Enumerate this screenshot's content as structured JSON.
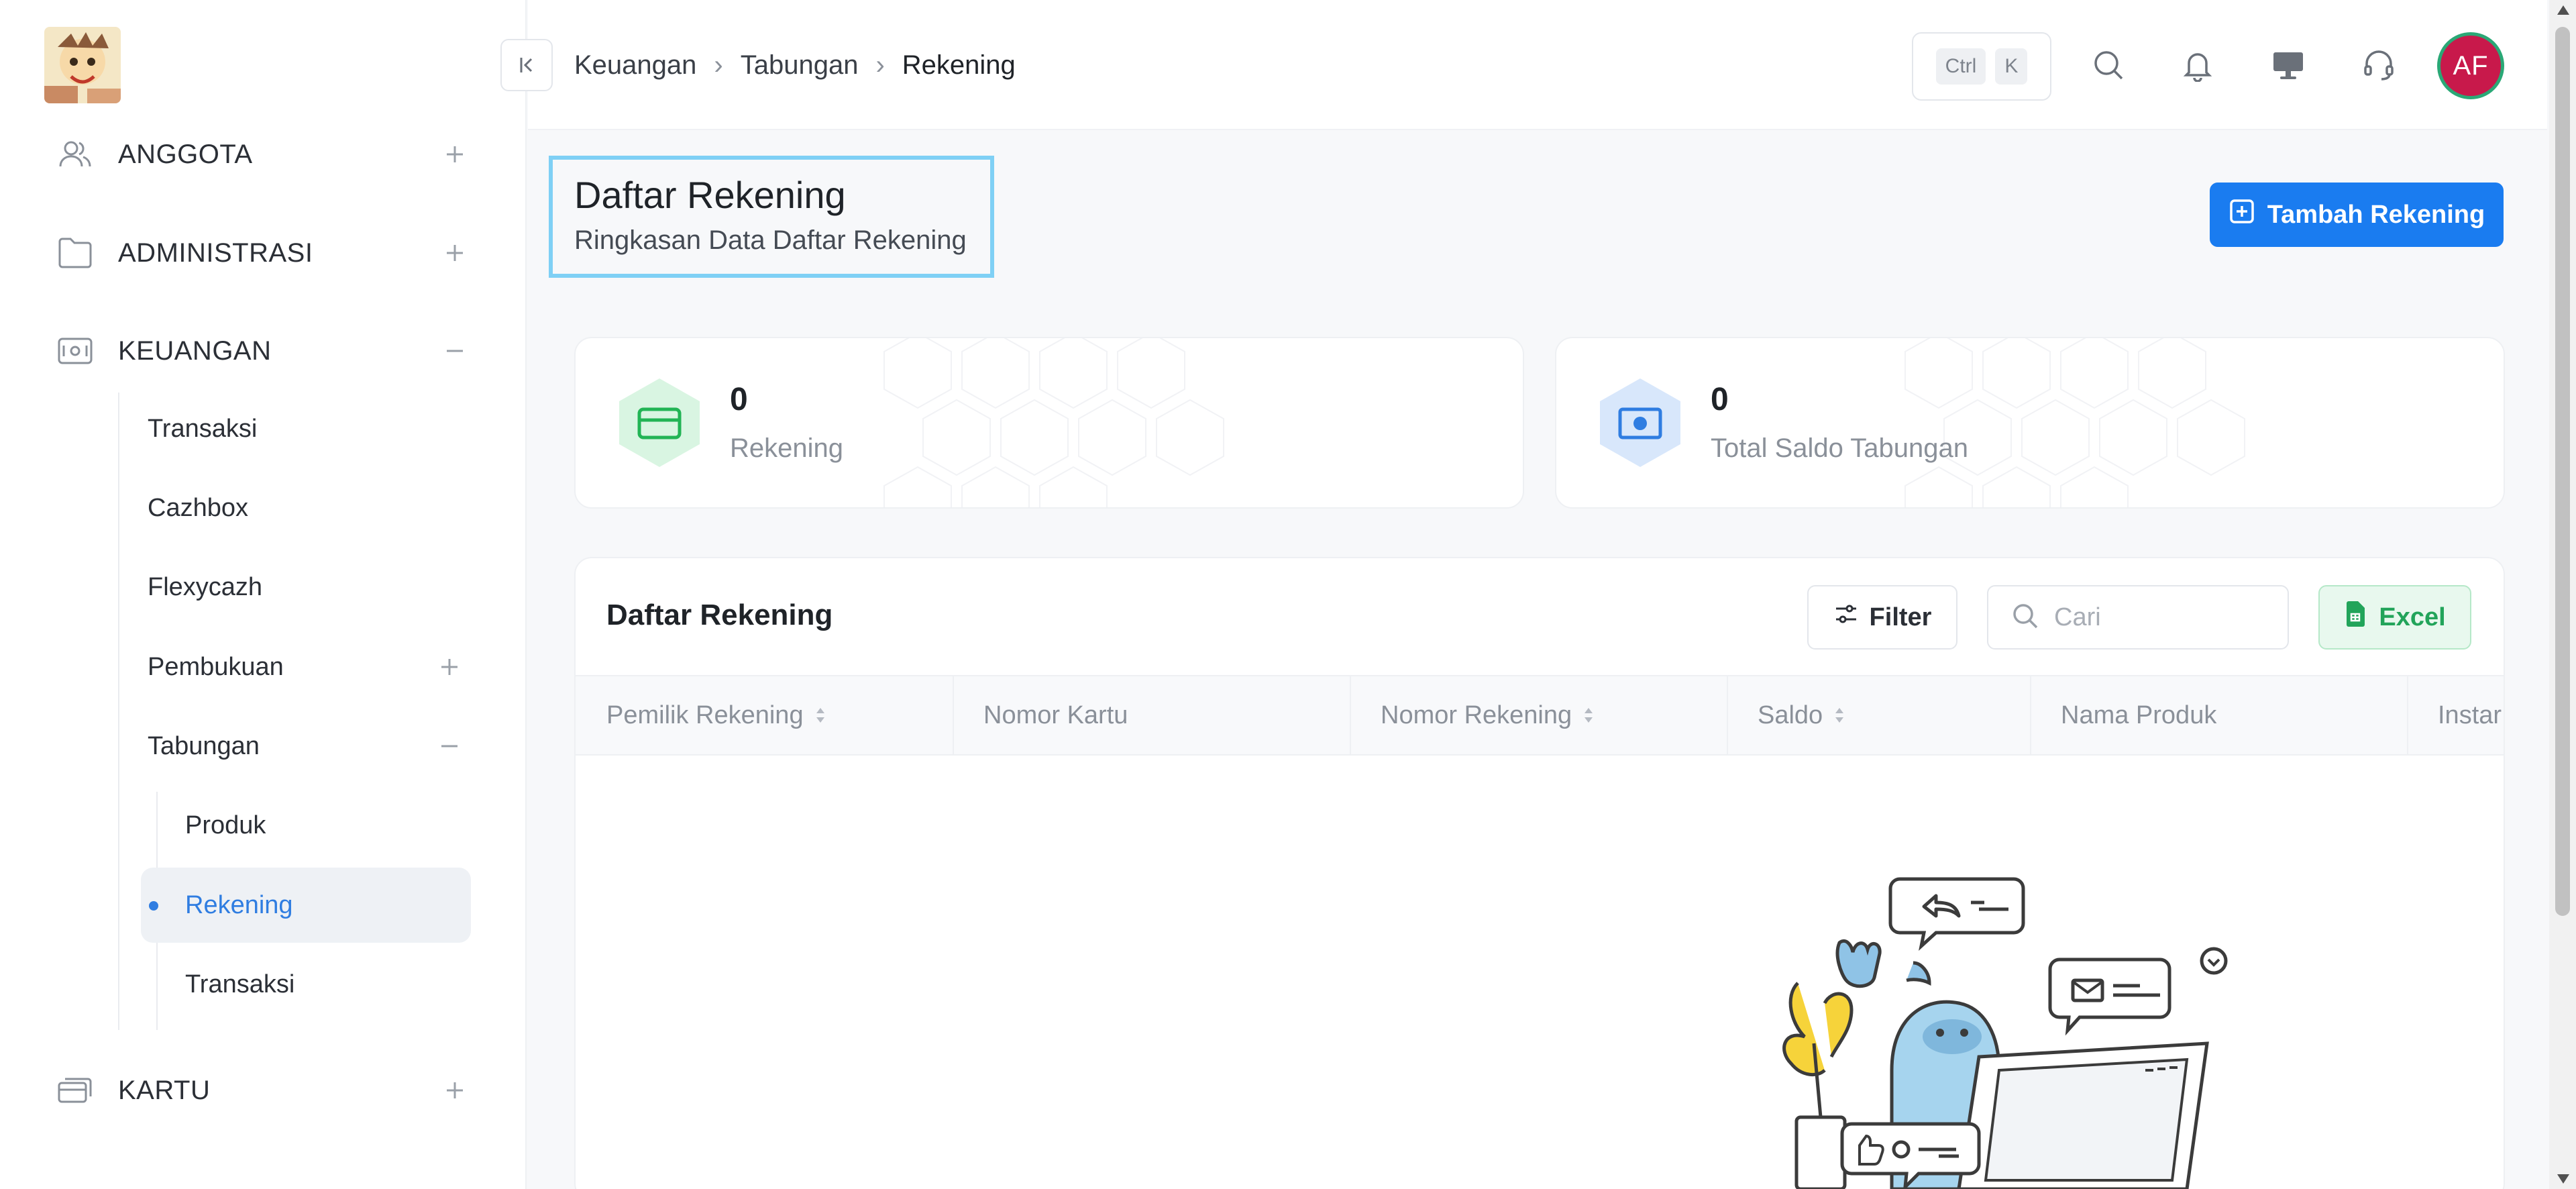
{
  "sidebar": {
    "groups": [
      {
        "label": "ANGGOTA",
        "toggle": "+"
      },
      {
        "label": "ADMINISTRASI",
        "toggle": "+"
      },
      {
        "label": "KEUANGAN",
        "toggle": "−"
      },
      {
        "label": "KARTU",
        "toggle": "+"
      }
    ],
    "keuangan_items": [
      {
        "label": "Transaksi"
      },
      {
        "label": "Cazhbox"
      },
      {
        "label": "Flexycazh"
      },
      {
        "label": "Pembukuan",
        "toggle": "+"
      },
      {
        "label": "Tabungan",
        "toggle": "−"
      }
    ],
    "tabungan_items": [
      {
        "label": "Produk"
      },
      {
        "label": "Rekening",
        "active": true
      },
      {
        "label": "Transaksi"
      }
    ]
  },
  "topbar": {
    "breadcrumb": [
      "Keuangan",
      "Tabungan",
      "Rekening"
    ],
    "shortcut": [
      "Ctrl",
      "K"
    ],
    "avatar_initials": "AF"
  },
  "header": {
    "title": "Daftar Rekening",
    "subtitle": "Ringkasan Data Daftar Rekening",
    "add_button": "Tambah Rekening"
  },
  "stats": [
    {
      "value": "0",
      "label": "Rekening",
      "icon": "card-icon",
      "color": "#22b455"
    },
    {
      "value": "0",
      "label": "Total Saldo Tabungan",
      "icon": "money-icon",
      "color": "#2f7de1"
    }
  ],
  "table": {
    "title": "Daftar Rekening",
    "filter_label": "Filter",
    "search_placeholder": "Cari",
    "excel_label": "Excel",
    "columns": [
      {
        "label": "Pemilik Rekening",
        "sortable": true
      },
      {
        "label": "Nomor Kartu",
        "sortable": false
      },
      {
        "label": "Nomor Rekening",
        "sortable": true
      },
      {
        "label": "Saldo",
        "sortable": true
      },
      {
        "label": "Nama Produk",
        "sortable": false
      },
      {
        "label": "Instar",
        "sortable": false
      }
    ]
  },
  "colors": {
    "primary": "#1a7cf0",
    "active_text": "#2f7de1",
    "excel_green": "#22a45a",
    "avatar_bg": "#c8194b"
  }
}
